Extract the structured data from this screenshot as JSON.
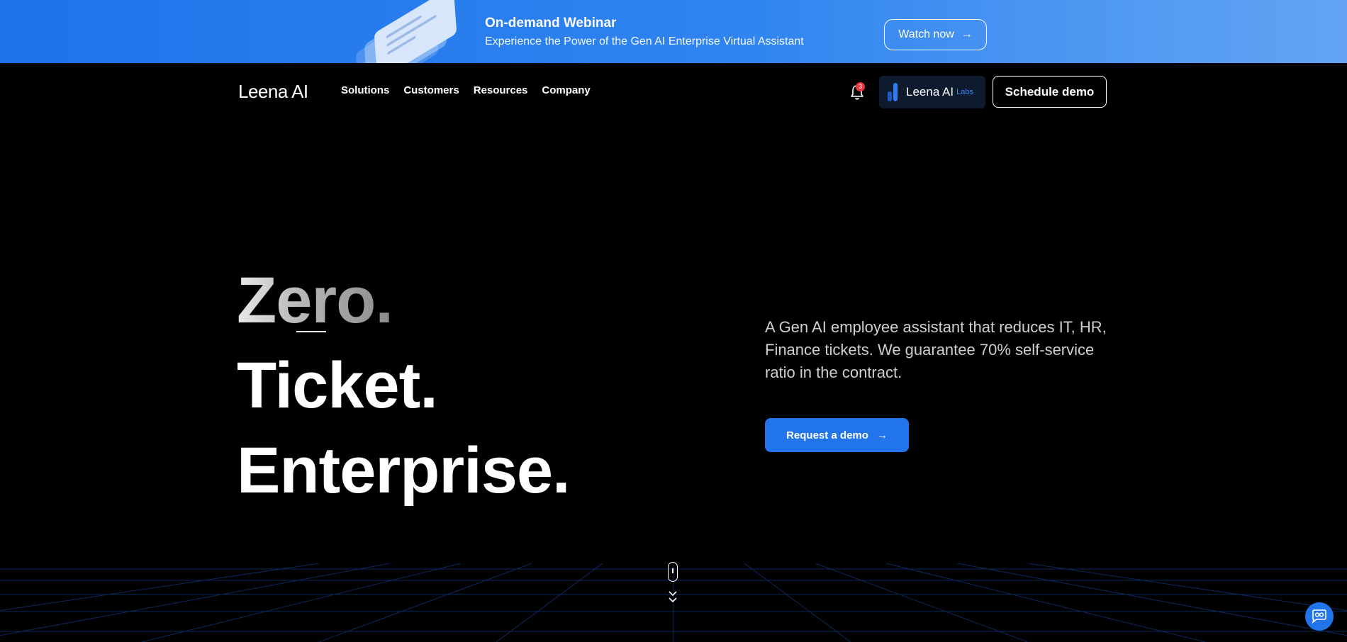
{
  "banner": {
    "title": "On-demand Webinar",
    "subtitle": "Experience the Power of the Gen AI Enterprise Virtual Assistant",
    "cta_label": "Watch now",
    "cta_arrow": "→"
  },
  "header": {
    "logo_text": "Leena AI",
    "nav": [
      {
        "label": "Solutions"
      },
      {
        "label": "Customers"
      },
      {
        "label": "Resources"
      },
      {
        "label": "Company"
      }
    ],
    "notification_count": "3",
    "labs_label": "Leena AI",
    "labs_tag": "Labs",
    "schedule_label": "Schedule demo"
  },
  "hero": {
    "line1": "Zero.",
    "line2": "Ticket.",
    "line3": "Enterprise.",
    "description": "A Gen AI employee assistant that reduces IT, HR, Finance tickets. We guarantee 70% self-service ratio in the contract.",
    "cta_label": "Request a demo",
    "cta_arrow": "→"
  },
  "colors": {
    "accent": "#2174ea",
    "banner_start": "#1f73ea",
    "banner_end": "#62a4f3",
    "badge": "#e8373d",
    "background": "#000000"
  },
  "icons": [
    "bell-icon",
    "arrow-right-icon",
    "leena-labs-logo-icon",
    "scroll-mouse-icon",
    "chevron-down-icon",
    "chat-bubble-icon"
  ]
}
